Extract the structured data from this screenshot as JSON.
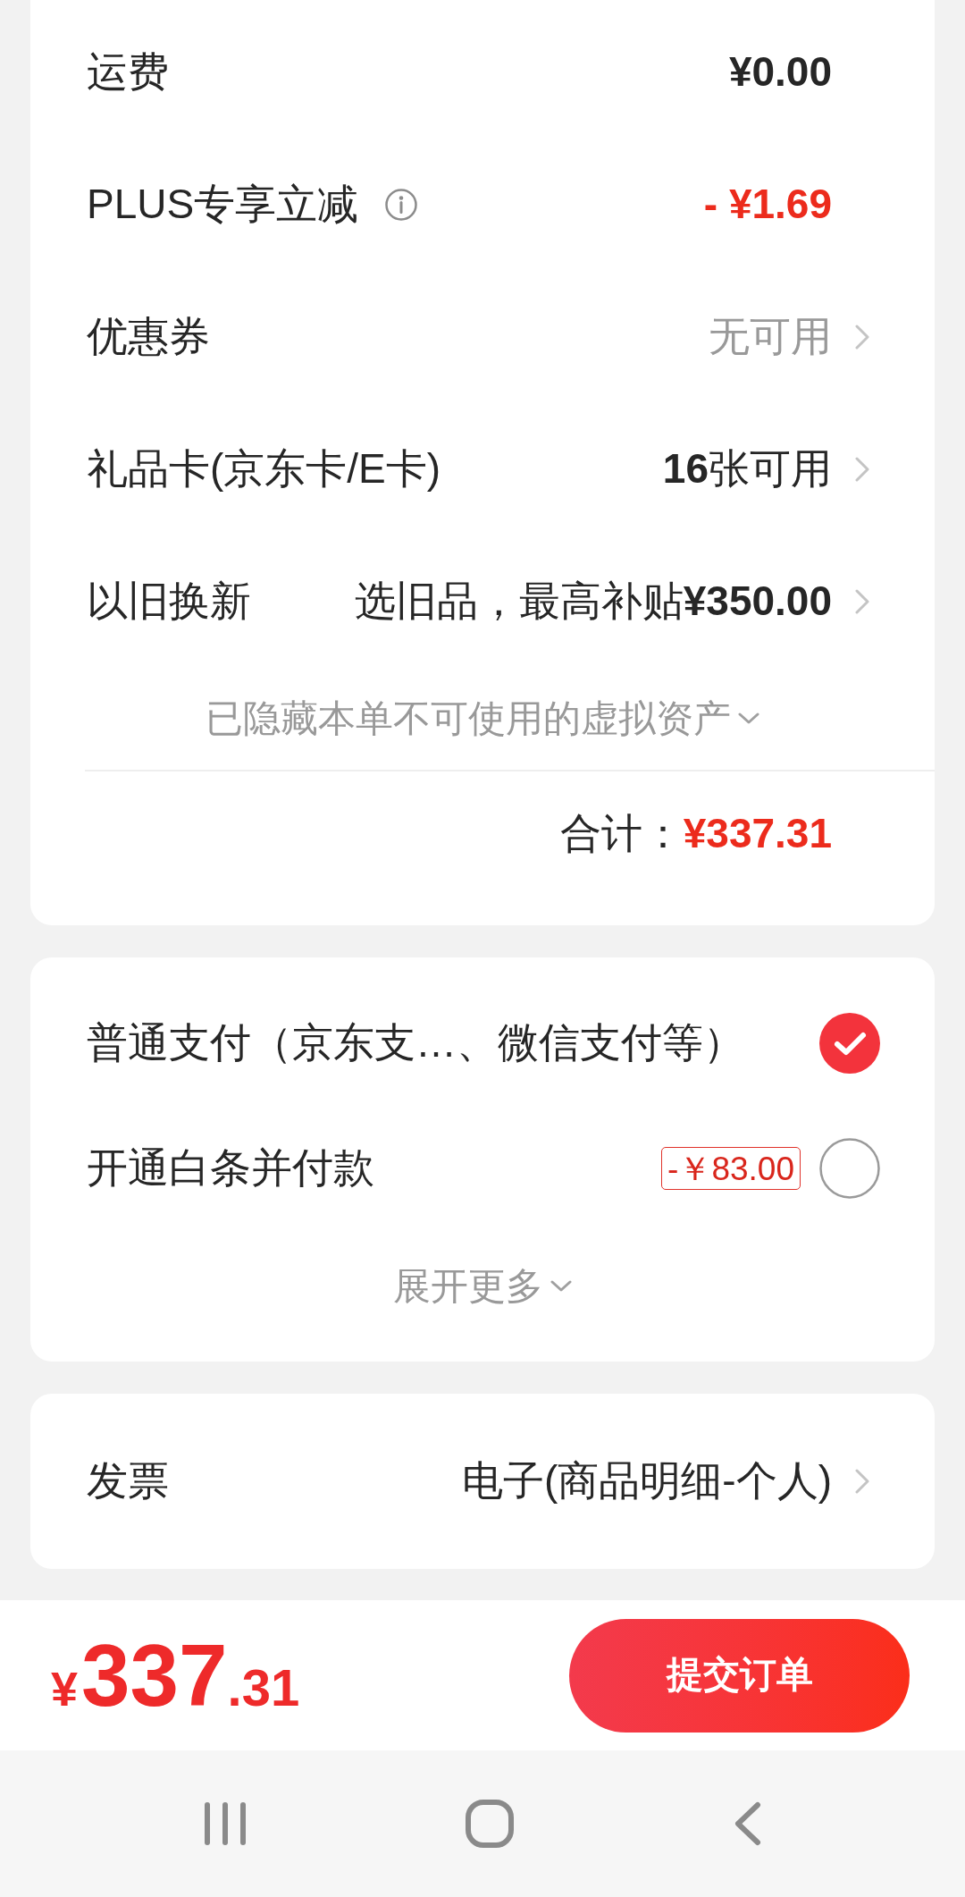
{
  "summary": {
    "rows": [
      {
        "label": "运费",
        "value": "¥0.00",
        "kind": "bold",
        "chevron": false
      },
      {
        "label": "PLUS专享立减",
        "info_icon": true,
        "value": "- ¥1.69",
        "kind": "discount",
        "chevron": false
      },
      {
        "label": "优惠券",
        "value": "无可用",
        "kind": "muted",
        "chevron": true
      },
      {
        "label": "礼品卡(京东卡/E卡)",
        "value": "**16**张可用",
        "kind": "normal",
        "chevron": true
      },
      {
        "label": "以旧换新",
        "value": "选旧品，最高补贴**¥350.00**",
        "kind": "normal",
        "chevron": true
      }
    ],
    "hidden_assets_note": "已隐藏本单不可使用的虚拟资产",
    "total": {
      "label": "合计：",
      "amount": "¥337.31"
    }
  },
  "payment": {
    "options": [
      {
        "label": "普通支付（京东支…、微信支付等）",
        "selected": true
      },
      {
        "label": "开通白条并付款",
        "badge": "-￥83.00",
        "selected": false
      }
    ],
    "expand_more": "展开更多"
  },
  "invoice": {
    "label": "发票",
    "value": "电子(商品明细-个人)",
    "chevron": true
  },
  "checkout_bar": {
    "price": {
      "currency": "¥",
      "integer": "337",
      "decimal": ".31"
    },
    "submit_button": "提交订单"
  }
}
